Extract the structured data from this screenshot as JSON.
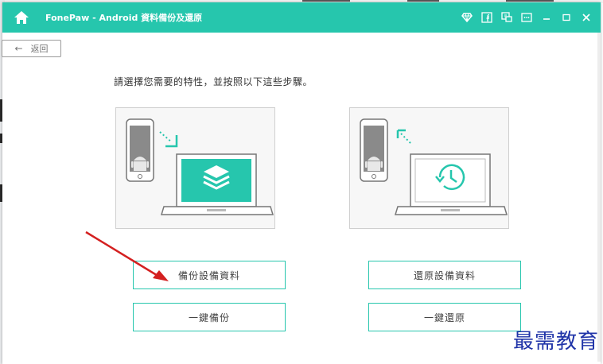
{
  "window": {
    "title": "FonePaw - Android 資料備份及還原",
    "accent": "#26c6ad"
  },
  "toolbar": {
    "icons": [
      "diamond-icon",
      "facebook-icon",
      "feedback-icon",
      "chat-icon",
      "minimize-icon",
      "maximize-icon",
      "close-icon"
    ]
  },
  "nav": {
    "back_label": "返回"
  },
  "main": {
    "instruction": "請選擇您需要的特性，並按照以下這些步驟。",
    "buttons": {
      "backup_data": "備份設備資料",
      "one_click_backup": "一鍵備份",
      "restore_data": "還原設備資料",
      "one_click_restore": "一鍵還原"
    }
  },
  "watermark": "最需教育"
}
